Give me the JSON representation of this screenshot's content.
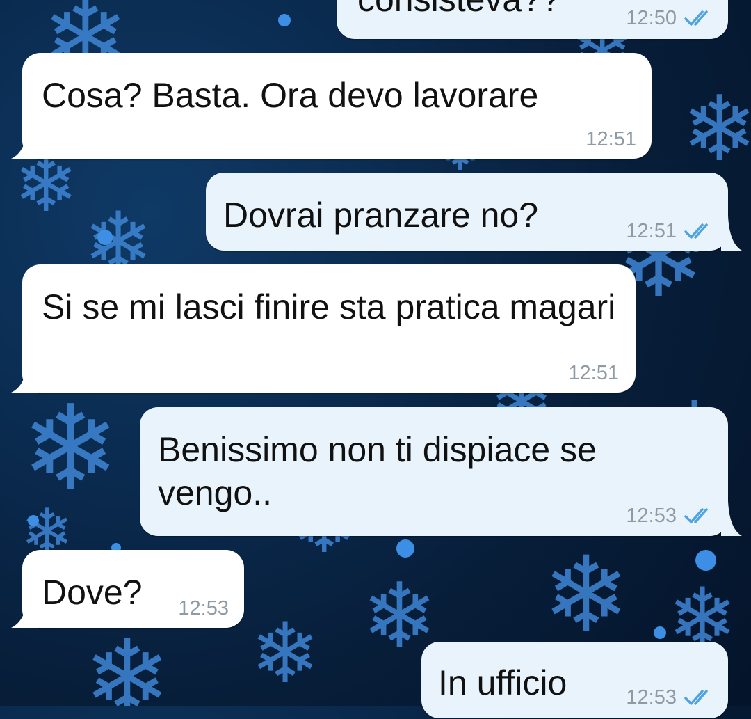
{
  "colors": {
    "background": "#0a2a4e",
    "incoming_bubble": "#ffffff",
    "outgoing_bubble": "#e8f3fb",
    "read_ticks": "#4fa3e0",
    "timestamp": "#8e9aa4"
  },
  "messages": [
    {
      "direction": "out",
      "text": "consisteva??",
      "time": "12:50",
      "status": "read"
    },
    {
      "direction": "in",
      "text": "Cosa? Basta. Ora devo lavorare",
      "time": "12:51"
    },
    {
      "direction": "out",
      "text": "Dovrai pranzare no?",
      "time": "12:51",
      "status": "read"
    },
    {
      "direction": "in",
      "text": "Si se mi lasci finire sta pratica magari",
      "time": "12:51"
    },
    {
      "direction": "out",
      "text": "Benissimo non ti dispiace se vengo..",
      "time": "12:53",
      "status": "read"
    },
    {
      "direction": "in",
      "text": "Dove?",
      "time": "12:53"
    },
    {
      "direction": "out",
      "text": "In ufficio",
      "time": "12:53",
      "status": "read"
    }
  ]
}
